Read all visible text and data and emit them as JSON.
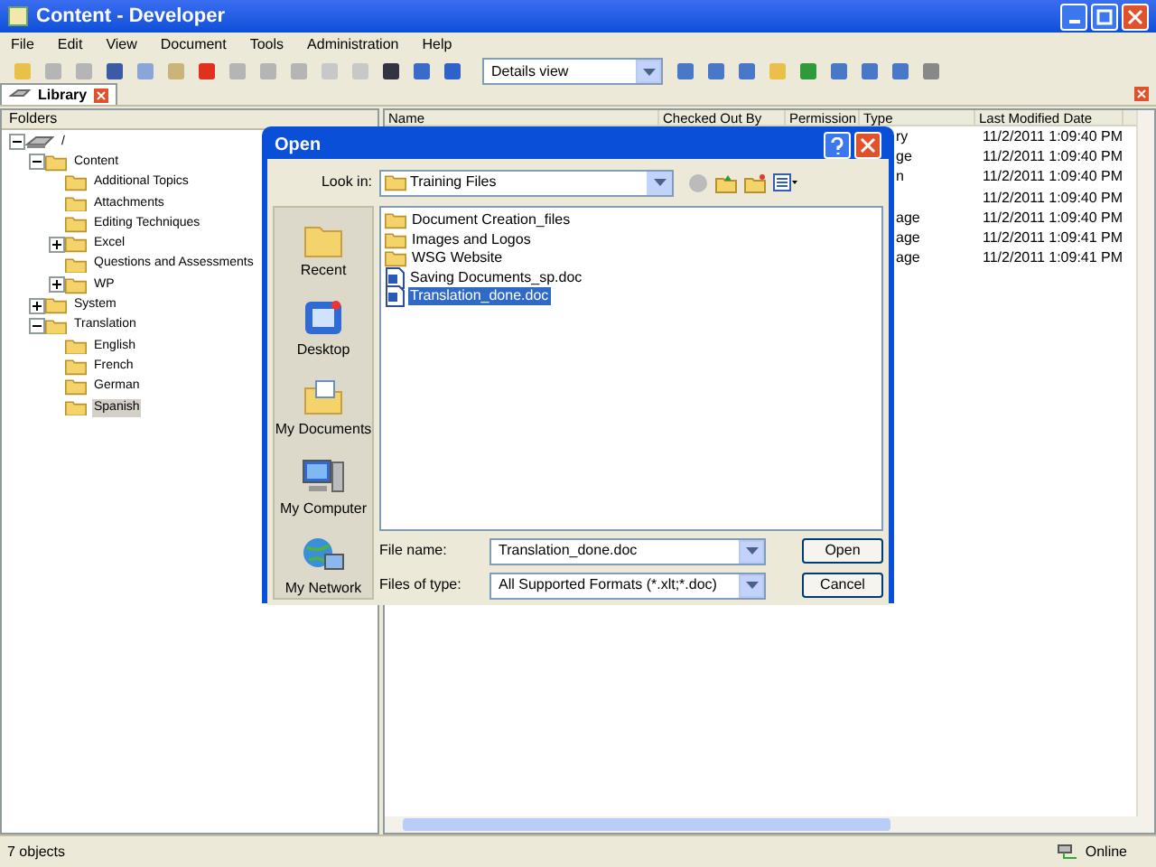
{
  "window": {
    "title": "Content - Developer"
  },
  "menu": [
    "File",
    "Edit",
    "View",
    "Document",
    "Tools",
    "Administration",
    "Help"
  ],
  "toolbar": {
    "view_select": "Details view"
  },
  "tabs": [
    {
      "label": "Library",
      "selected": true
    }
  ],
  "folders": {
    "header": "Folders",
    "tree": [
      {
        "label": "/",
        "selected": false,
        "expanded": true,
        "children": [
          {
            "label": "Content",
            "selected": false,
            "expanded": true,
            "children": [
              {
                "label": "Additional Topics",
                "selected": false
              },
              {
                "label": "Attachments",
                "selected": false
              },
              {
                "label": "Editing Techniques",
                "selected": false
              },
              {
                "label": "Excel",
                "selected": false,
                "expanded": false
              },
              {
                "label": "Questions and Assessments",
                "selected": false
              },
              {
                "label": "WP",
                "selected": false,
                "expanded": false
              }
            ]
          },
          {
            "label": "System",
            "selected": false,
            "expanded": false
          },
          {
            "label": "Translation",
            "selected": false,
            "expanded": true,
            "children": [
              {
                "label": "English",
                "selected": false
              },
              {
                "label": "French",
                "selected": false
              },
              {
                "label": "German",
                "selected": false
              },
              {
                "label": "Spanish",
                "selected": true
              }
            ]
          }
        ]
      }
    ]
  },
  "table": {
    "columns": [
      "Name",
      "Checked Out By",
      "Permission",
      "Type",
      "Last Modified Date"
    ],
    "rows": [
      {
        "type": "ry",
        "date": "11/2/2011 1:09:40 PM"
      },
      {
        "type": "ge",
        "date": "11/2/2011 1:09:40 PM"
      },
      {
        "type": "n",
        "date": "11/2/2011 1:09:40 PM"
      },
      {
        "type": "",
        "date": "11/2/2011 1:09:40 PM"
      },
      {
        "type": "age",
        "date": "11/2/2011 1:09:40 PM"
      },
      {
        "type": "age",
        "date": "11/2/2011 1:09:41 PM"
      },
      {
        "type": "age",
        "date": "11/2/2011 1:09:41 PM"
      }
    ]
  },
  "dialog": {
    "title": "Open",
    "look_in_label": "Look in:",
    "look_in": "Training Files",
    "places": [
      {
        "label": "Recent",
        "kind": "recent"
      },
      {
        "label": "Desktop",
        "kind": "desktop"
      },
      {
        "label": "My Documents",
        "kind": "documents"
      },
      {
        "label": "My Computer",
        "kind": "computer"
      },
      {
        "label": "My Network",
        "kind": "network"
      }
    ],
    "files": [
      {
        "name": "Document Creation_files",
        "kind": "folder",
        "selected": false
      },
      {
        "name": "Images and Logos",
        "kind": "folder",
        "selected": false
      },
      {
        "name": "WSG Website",
        "kind": "folder",
        "selected": false
      },
      {
        "name": "Saving Documents_sp.doc",
        "kind": "doc",
        "selected": false
      },
      {
        "name": "Translation_done.doc",
        "kind": "doc",
        "selected": true
      }
    ],
    "file_name_label": "File name:",
    "file_name": "Translation_done.doc",
    "file_type_label": "Files of type:",
    "file_type": "All Supported Formats (*.xlt;*.doc)",
    "buttons": [
      "Open",
      "Cancel"
    ]
  },
  "status_bar": {
    "count": "7 objects",
    "connection": "Online"
  }
}
